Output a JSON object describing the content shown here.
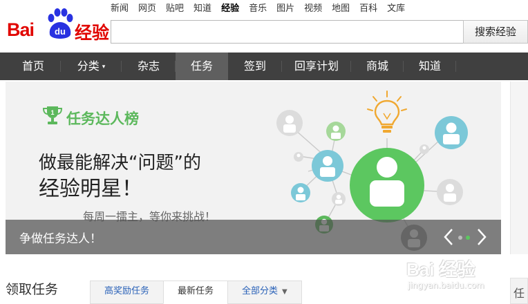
{
  "top_nav": [
    "新闻",
    "网页",
    "贴吧",
    "知道",
    "经验",
    "音乐",
    "图片",
    "视频",
    "地图",
    "百科",
    "文库"
  ],
  "top_nav_active": "经验",
  "logo": {
    "bai": "Bai",
    "du": "du",
    "jingyan": "经验"
  },
  "search": {
    "value": "",
    "button_label": "搜索经验"
  },
  "main_nav": {
    "items": [
      "首页",
      "分类",
      "杂志",
      "任务",
      "签到",
      "回享计划",
      "商城",
      "知道"
    ],
    "active": "任务",
    "dropdown_item": "分类"
  },
  "banner": {
    "title": "任务达人榜",
    "headline_line1": "做最能解决“问题”的",
    "headline_line2": "经验明星！",
    "tagline": "每周一擂主，等你来挑战！",
    "caption": "争做任务达人！",
    "slide_count": 2,
    "current_slide": 2
  },
  "colors": {
    "accent_green": "#5cb85c",
    "nav_bg": "#404040",
    "logo_red": "#e10601",
    "link_blue": "#2a62b8"
  },
  "section": {
    "title": "领取任务"
  },
  "tabs": [
    {
      "label": "高奖励任务",
      "active": false
    },
    {
      "label": "最新任务",
      "active": true
    },
    {
      "label": "全部分类",
      "active": false,
      "dropdown": true
    }
  ],
  "watermark": {
    "logo": "Bai 经验",
    "url": "jingyan.baidu.com"
  },
  "side_panel_text": "任"
}
